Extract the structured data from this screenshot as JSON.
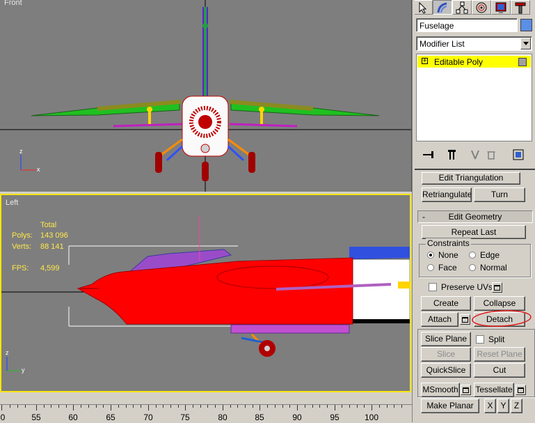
{
  "viewports": {
    "front": {
      "label": "Front"
    },
    "left": {
      "label": "Left",
      "stats": {
        "header": "Total",
        "polys_label": "Polys:",
        "polys_value": "143 096",
        "verts_label": "Verts:",
        "verts_value": "88 141",
        "fps_label": "FPS:",
        "fps_value": "4,599"
      }
    }
  },
  "ruler": {
    "labels": [
      "0",
      "55",
      "60",
      "65",
      "70",
      "75",
      "80",
      "85",
      "90",
      "95",
      "100"
    ]
  },
  "panel": {
    "tabs": [
      "create-icon",
      "modify-icon",
      "hierarchy-icon",
      "motion-icon",
      "display-icon",
      "utilities-icon"
    ],
    "object_name": "Fuselage",
    "object_color": "#5b8ee6",
    "modifier_list": "Modifier List",
    "stack_item": "Editable Poly",
    "stack_item_sign": "+",
    "edit_triangulation": "Edit Triangulation",
    "retriangulate": "Retriangulate",
    "turn": "Turn",
    "edit_geometry_title": "Edit Geometry",
    "collapse_sign": "-",
    "repeat_last": "Repeat Last",
    "constraints": {
      "title": "Constraints",
      "none": "None",
      "edge": "Edge",
      "face": "Face",
      "normal": "Normal",
      "selected": "None"
    },
    "preserve_uvs": "Preserve UVs",
    "create": "Create",
    "collapse": "Collapse",
    "attach": "Attach",
    "detach": "Detach",
    "slice_plane": "Slice Plane",
    "split": "Split",
    "slice": "Slice",
    "reset_plane": "Reset Plane",
    "quickslice": "QuickSlice",
    "cut": "Cut",
    "msmooth": "MSmooth",
    "tessellate": "Tessellate",
    "make_planar": "Make Planar",
    "x": "X",
    "y": "Y",
    "z": "Z"
  },
  "colors": {
    "viewport_bg": "#7e7e7e",
    "active_border": "#ffe600",
    "fuselage": "#ff0000",
    "stack_highlight": "#ffff00",
    "stats_text": "#ffe84a",
    "annotation_circle": "#e01818"
  }
}
